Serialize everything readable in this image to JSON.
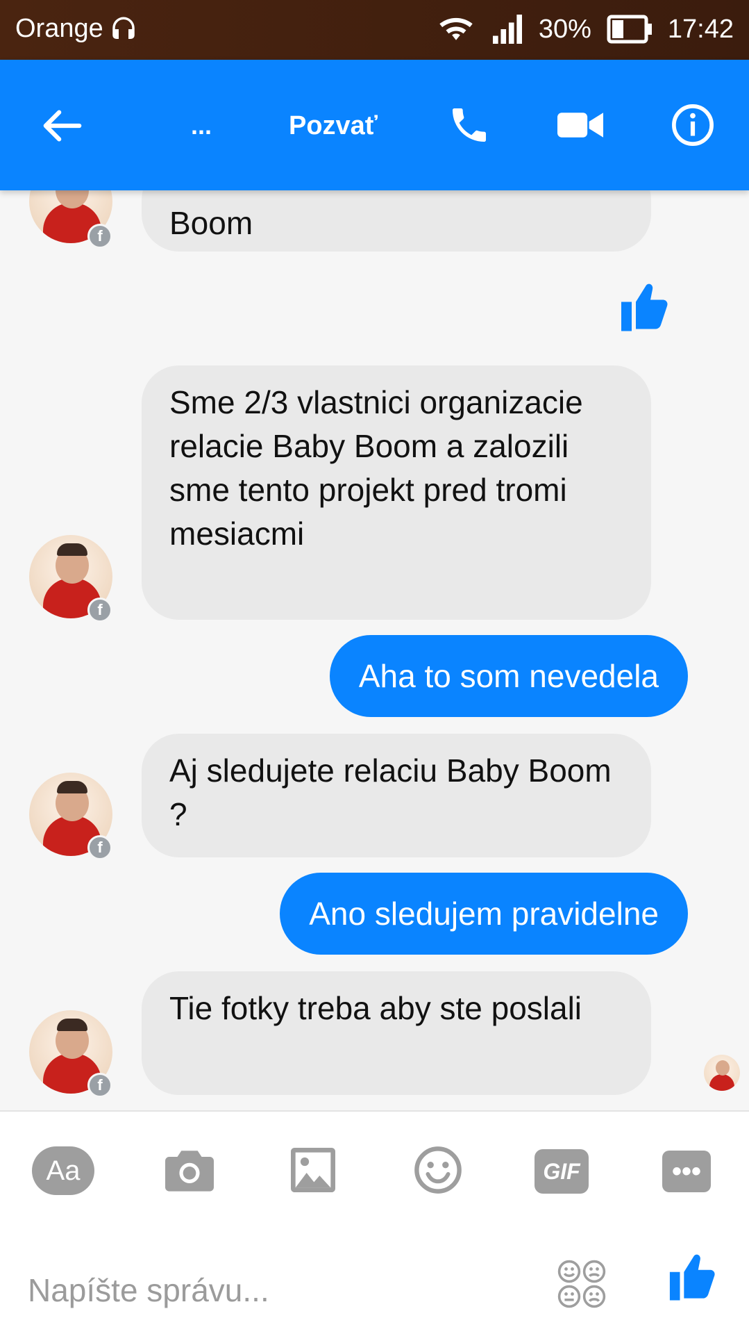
{
  "status_bar": {
    "carrier": "Orange",
    "battery": "30%",
    "time": "17:42"
  },
  "header": {
    "title": "...",
    "invite_label": "Pozvať"
  },
  "messages": [
    {
      "dir": "in",
      "text": "Boom"
    },
    {
      "dir": "out",
      "type": "like"
    },
    {
      "dir": "in",
      "text": "Sme 2/3 vlastnici organizacie relacie Baby Boom a zalozili sme tento projekt pred tromi mesiacmi"
    },
    {
      "dir": "out",
      "text": "Aha to som nevedela"
    },
    {
      "dir": "in",
      "text": "Aj sledujete relaciu Baby Boom ?"
    },
    {
      "dir": "out",
      "text": "Ano sledujem pravidelne"
    },
    {
      "dir": "in",
      "text": "Tie fotky treba aby ste poslali"
    }
  ],
  "composer": {
    "aa_label": "Aa",
    "gif_label": "GIF",
    "more_label": "•••",
    "placeholder": "Napíšte správu..."
  },
  "colors": {
    "accent": "#0a84ff",
    "status_bar": "#3f1e0e",
    "incoming_bubble": "#e9e9e9",
    "icon_gray": "#9e9e9e"
  },
  "icons": {
    "back": "arrow-left-icon",
    "call": "phone-icon",
    "video": "video-camera-icon",
    "info": "info-icon",
    "camera": "camera-icon",
    "image": "image-icon",
    "emoji": "smiley-icon",
    "like": "thumbs-up-icon"
  }
}
